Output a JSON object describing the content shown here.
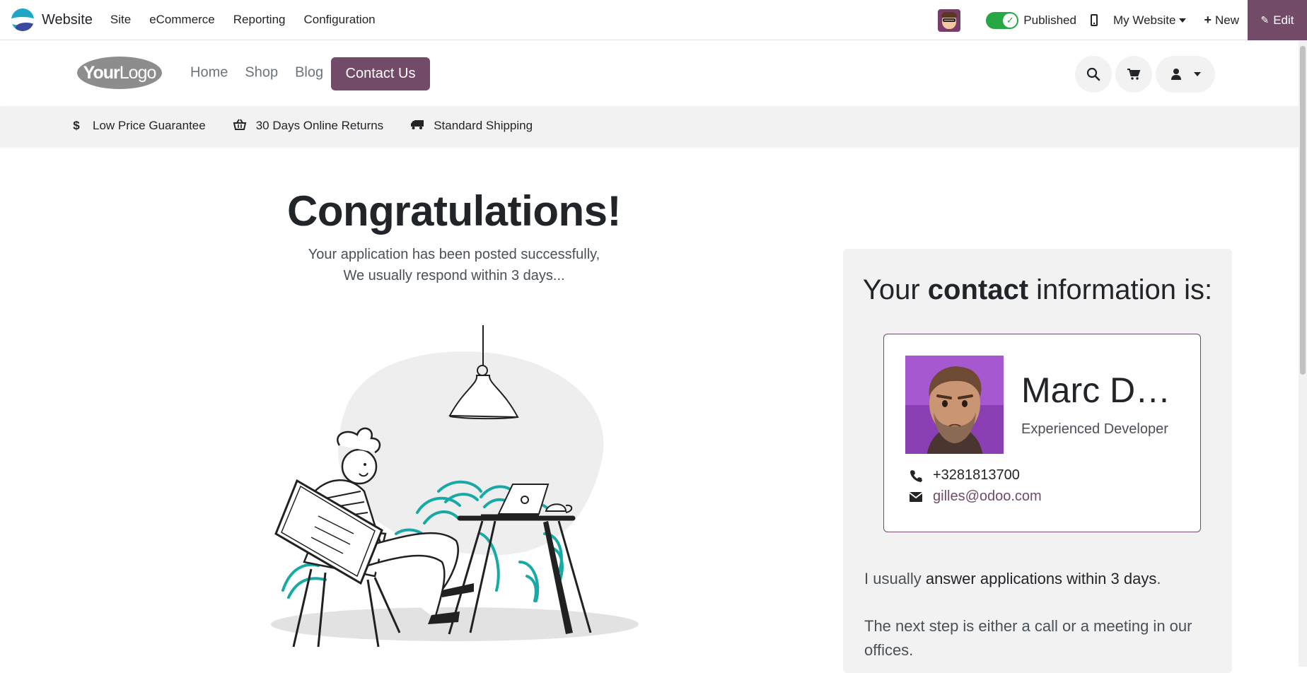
{
  "topbar": {
    "app_name": "Website",
    "menu": [
      "Site",
      "eCommerce",
      "Reporting",
      "Configuration"
    ],
    "published_label": "Published",
    "website_label": "My Website",
    "new_label": "New",
    "edit_label": "Edit"
  },
  "header": {
    "logo_text_bold": "Your",
    "logo_text_light": "Logo",
    "nav": [
      "Home",
      "Shop",
      "Blog"
    ],
    "contact_label": "Contact Us"
  },
  "promos": [
    "Low Price Guarantee",
    "30 Days Online Returns",
    "Standard Shipping"
  ],
  "main": {
    "title": "Congratulations!",
    "line1": "Your application has been posted successfully,",
    "line2": "We usually respond within 3 days..."
  },
  "contact": {
    "title_pre": "Your ",
    "title_bold": "contact",
    "title_post": " information is:",
    "name": "Marc Demo",
    "job": "Experienced Developer",
    "phone": "+3281813700",
    "email": "gilles@odoo.com",
    "text1_pre": "I usually ",
    "text1_bold": "answer applications within 3 days",
    "text1_post": ".",
    "text2": "The next step is either a call or a meeting in our offices."
  },
  "colors": {
    "primary": "#714b67",
    "toggle": "#28a745",
    "teal": "#17a9a5"
  }
}
